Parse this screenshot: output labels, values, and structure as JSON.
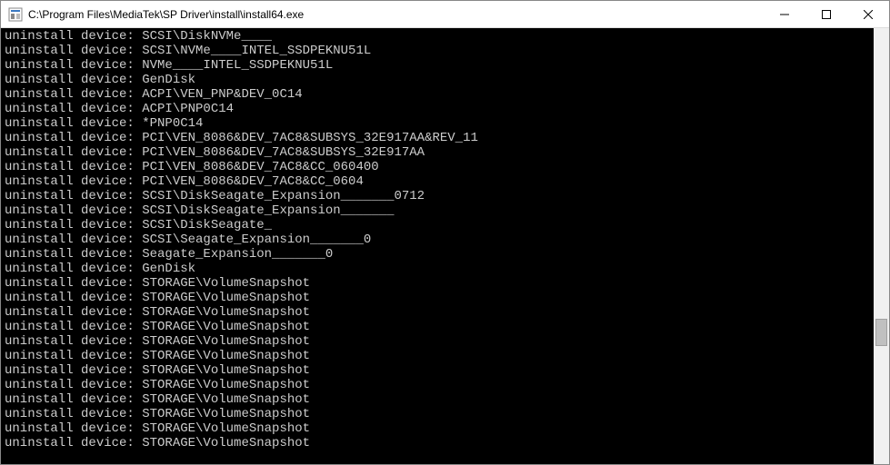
{
  "window": {
    "title": "C:\\Program Files\\MediaTek\\SP Driver\\install\\install64.exe"
  },
  "console": {
    "prefix": "uninstall device: ",
    "lines": [
      "SCSI\\DiskNVMe____",
      "SCSI\\NVMe____INTEL_SSDPEKNU51L",
      "NVMe____INTEL_SSDPEKNU51L",
      "GenDisk",
      "ACPI\\VEN_PNP&DEV_0C14",
      "ACPI\\PNP0C14",
      "*PNP0C14",
      "PCI\\VEN_8086&DEV_7AC8&SUBSYS_32E917AA&REV_11",
      "PCI\\VEN_8086&DEV_7AC8&SUBSYS_32E917AA",
      "PCI\\VEN_8086&DEV_7AC8&CC_060400",
      "PCI\\VEN_8086&DEV_7AC8&CC_0604",
      "SCSI\\DiskSeagate_Expansion_______0712",
      "SCSI\\DiskSeagate_Expansion_______",
      "SCSI\\DiskSeagate_",
      "SCSI\\Seagate_Expansion_______0",
      "Seagate_Expansion_______0",
      "GenDisk",
      "STORAGE\\VolumeSnapshot",
      "STORAGE\\VolumeSnapshot",
      "STORAGE\\VolumeSnapshot",
      "STORAGE\\VolumeSnapshot",
      "STORAGE\\VolumeSnapshot",
      "STORAGE\\VolumeSnapshot",
      "STORAGE\\VolumeSnapshot",
      "STORAGE\\VolumeSnapshot",
      "STORAGE\\VolumeSnapshot",
      "STORAGE\\VolumeSnapshot",
      "STORAGE\\VolumeSnapshot",
      "STORAGE\\VolumeSnapshot"
    ]
  }
}
